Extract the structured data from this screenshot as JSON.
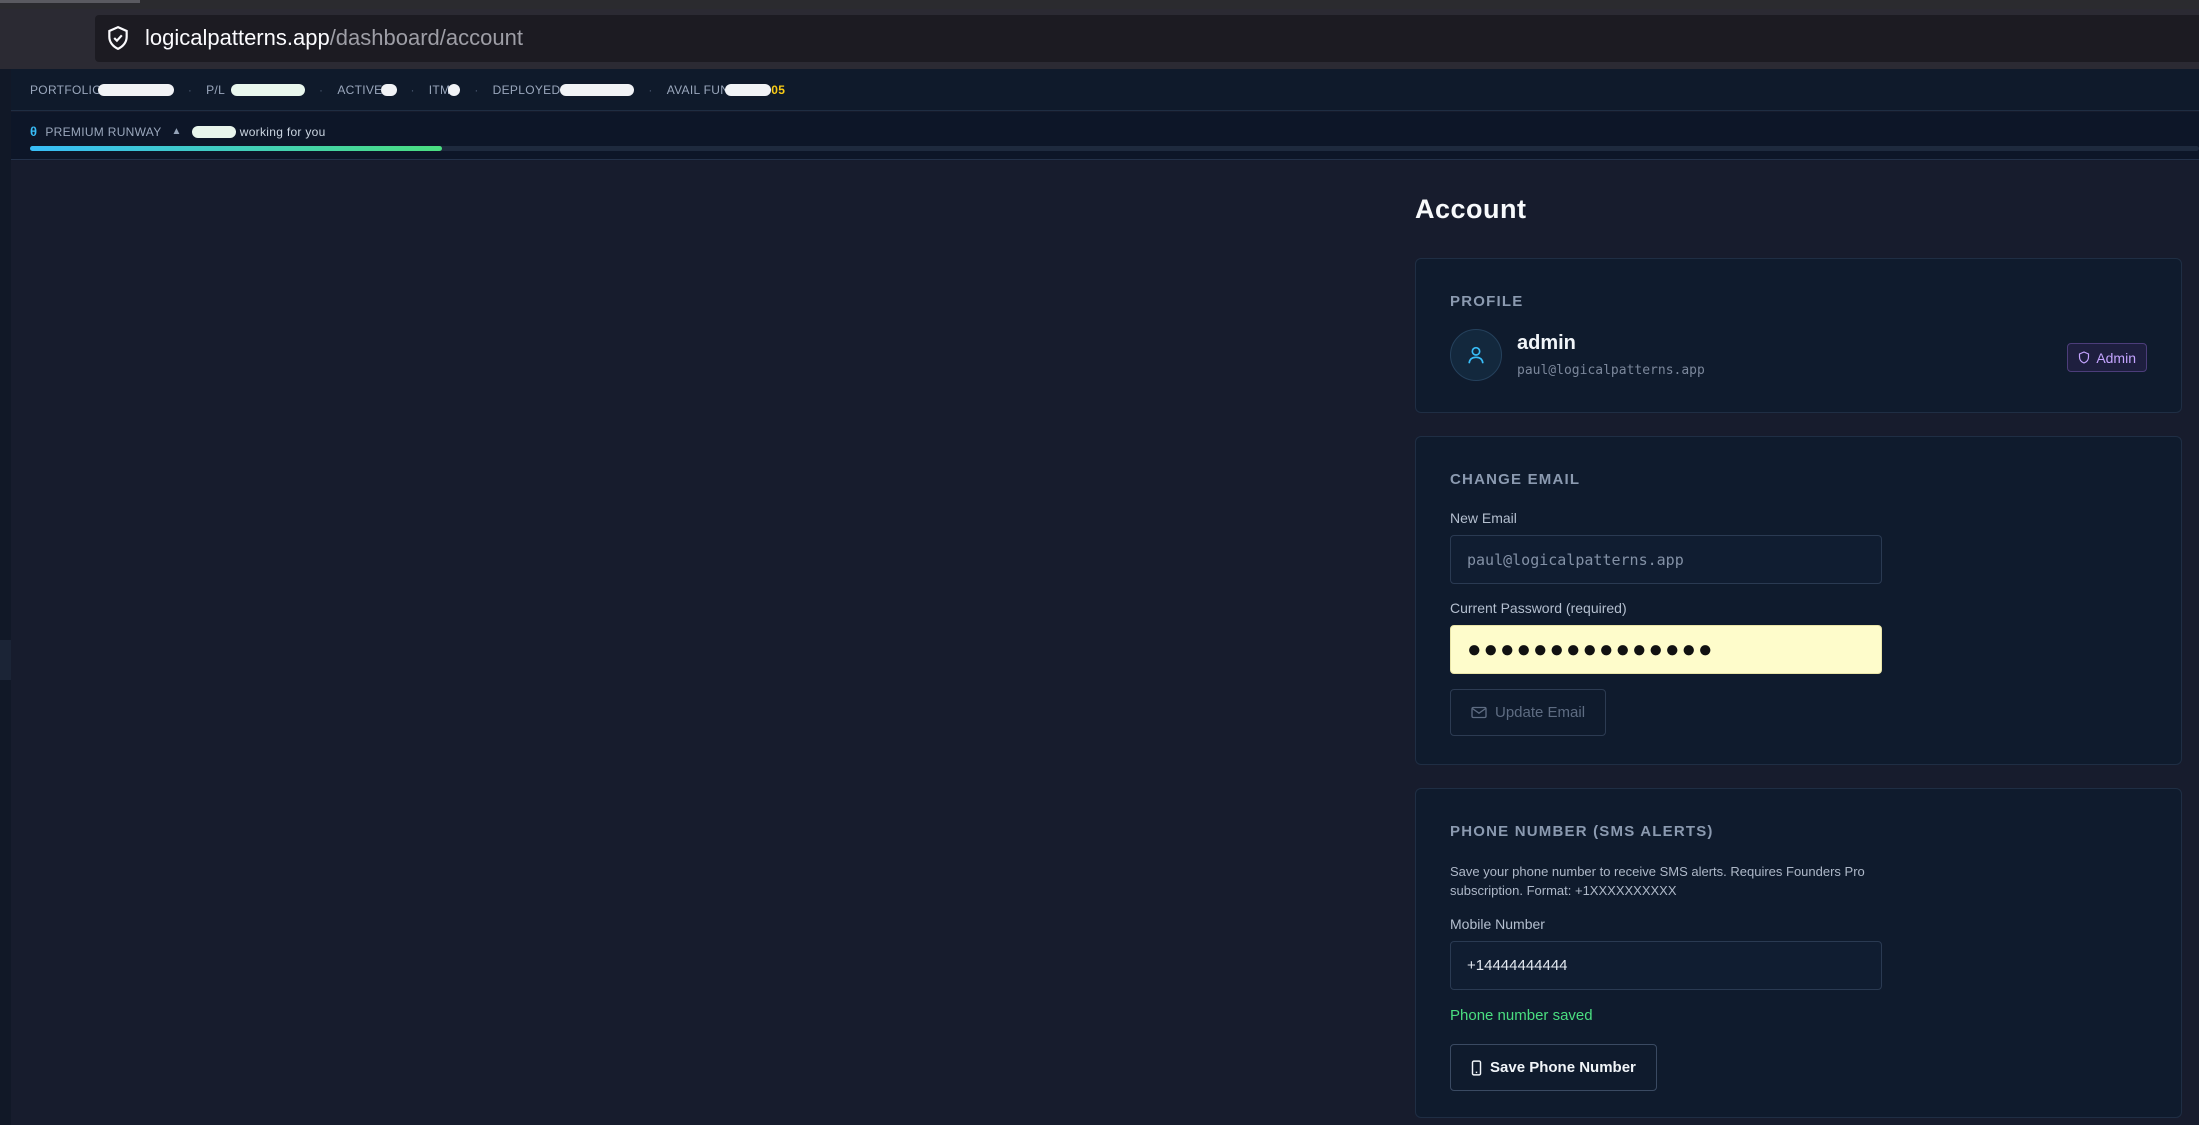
{
  "browser": {
    "url_host": "logicalpatterns.app",
    "url_path": "/dashboard/account"
  },
  "ticker": {
    "portfolio_label": "PORTFOLIO",
    "pl_label": "P/L",
    "active_label": "ACTIVE",
    "itm_label": "ITM",
    "deployed_label": "DEPLOYED",
    "avail_funds_label": "AVAIL FUN",
    "avail_funds_tail": "05"
  },
  "runway": {
    "icon": "θ",
    "label": "PREMIUM RUNWAY",
    "arrow": "▲",
    "note": "working for you",
    "progress": 0.19
  },
  "page": {
    "title": "Account"
  },
  "profile": {
    "section_title": "PROFILE",
    "name": "admin",
    "email": "paul@logicalpatterns.app",
    "badge": "Admin"
  },
  "change_email": {
    "section_title": "CHANGE EMAIL",
    "new_email_label": "New Email",
    "new_email_placeholder": "paul@logicalpatterns.app",
    "password_label": "Current Password (required)",
    "password_value": "●●●●●●●●●●●●●●●",
    "button_label": "Update Email"
  },
  "phone": {
    "section_title": "PHONE NUMBER (SMS ALERTS)",
    "description": "Save your phone number to receive SMS alerts. Requires Founders Pro subscription. Format: +1XXXXXXXXXX",
    "mobile_label": "Mobile Number",
    "mobile_value": "+14444444444",
    "status": "Phone number saved",
    "button_label": "Save Phone Number"
  },
  "colors": {
    "accent_green": "#4ade80",
    "accent_blue": "#38bdf8",
    "admin_purple": "#c4a4ff",
    "password_autofill": "#fefccb"
  }
}
